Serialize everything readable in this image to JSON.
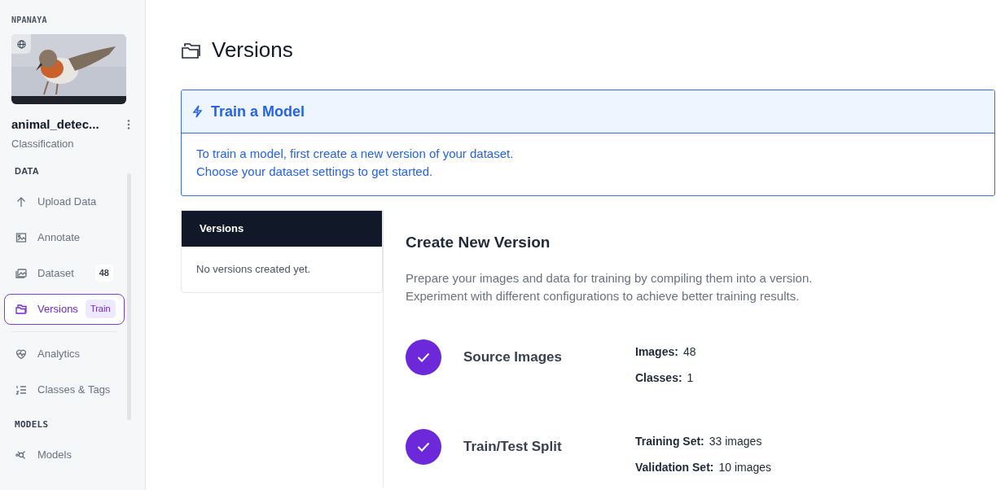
{
  "workspace": "NPANAYA",
  "project": {
    "name": "animal_detec...",
    "type": "Classification",
    "public": true
  },
  "nav_sections": [
    {
      "title": "DATA",
      "items": [
        {
          "label": "Upload Data",
          "selected": false
        },
        {
          "label": "Annotate",
          "selected": false
        },
        {
          "label": "Dataset",
          "selected": false,
          "badge": "48"
        },
        {
          "label": "Versions",
          "selected": true,
          "badge": "Train"
        },
        {
          "label": "Analytics",
          "selected": false
        },
        {
          "label": "Classes & Tags",
          "selected": false
        }
      ]
    },
    {
      "title": "MODELS",
      "items": [
        {
          "label": "Models",
          "selected": false
        }
      ]
    }
  ],
  "page_title": "Versions",
  "alert": {
    "title": "Train a Model",
    "lines": [
      "To train a model, first create a new version of your dataset.",
      "Choose your dataset settings to get started."
    ]
  },
  "versions_panel": {
    "header": "Versions",
    "empty": "No versions created yet."
  },
  "create": {
    "title": "Create New Version",
    "description": [
      "Prepare your images and data for training by compiling them into a version.",
      "Experiment with different configurations to achieve better training results."
    ],
    "steps": [
      {
        "title": "Source Images",
        "done": true,
        "details": [
          {
            "label": "Images:",
            "value": "48"
          },
          {
            "label": "Classes:",
            "value": "1"
          }
        ]
      },
      {
        "title": "Train/Test Split",
        "done": true,
        "details": [
          {
            "label": "Training Set:",
            "value": "33 images"
          },
          {
            "label": "Validation Set:",
            "value": "10 images"
          }
        ]
      }
    ]
  }
}
